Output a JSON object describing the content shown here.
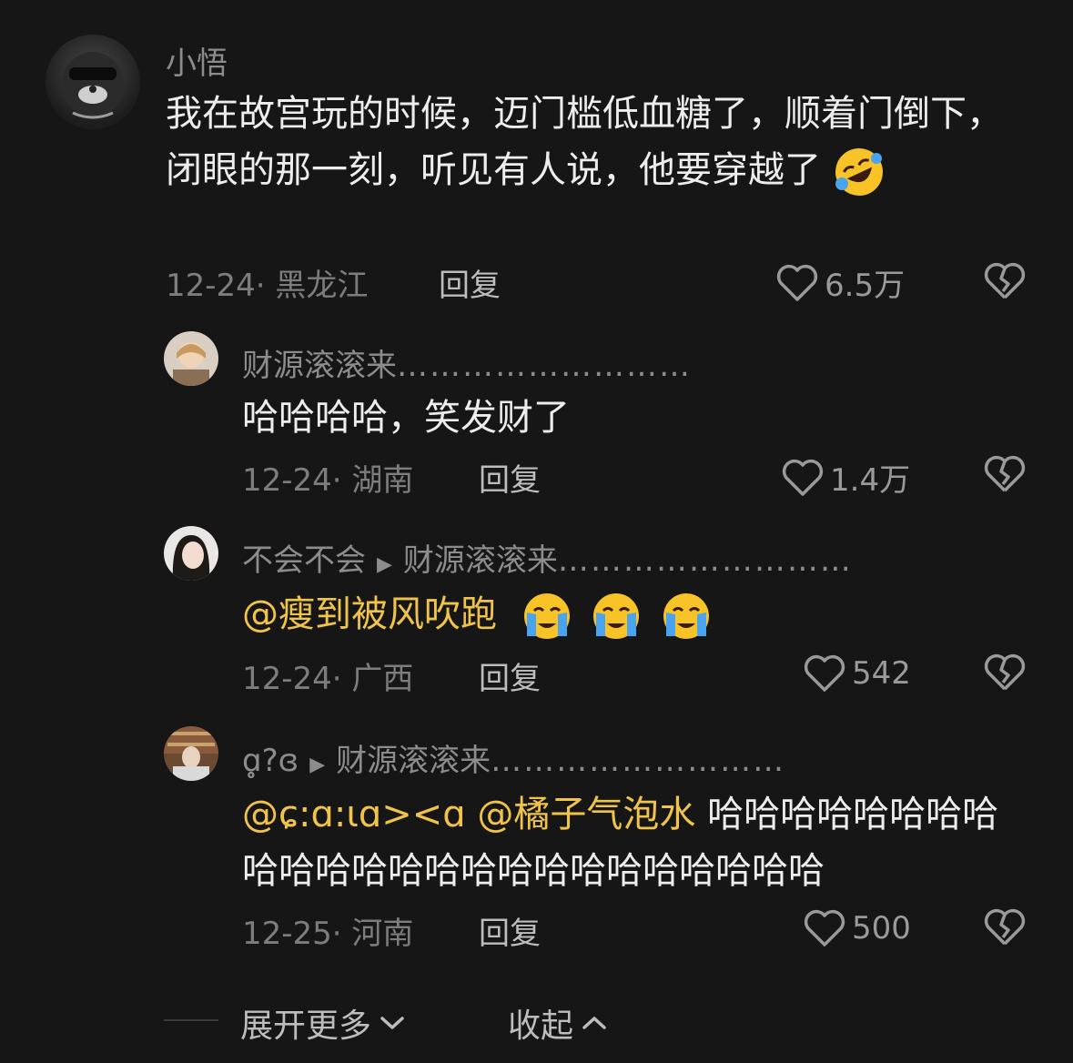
{
  "comments": [
    {
      "user": "小悟",
      "text": "我在故宫玩的时候，迈门槛低血糖了，顺着门倒下，闭眼的那一刻，听见有人说，他要穿越了",
      "emoji": "rofl-emoji",
      "date": "12-24",
      "location": "黑龙江",
      "reply_label": "回复",
      "likes": "6.5万"
    },
    {
      "user": "财源滚滚来",
      "user_dots": "………………………",
      "text": "哈哈哈哈，笑发财了",
      "date": "12-24",
      "location": "湖南",
      "reply_label": "回复",
      "likes": "1.4万"
    },
    {
      "user": "不会不会",
      "reply_to": "财源滚滚来",
      "reply_to_dots": "………………………",
      "mention": "@瘦到被风吹跑",
      "emojis": [
        "crying-face-emoji",
        "crying-face-emoji",
        "crying-face-emoji"
      ],
      "date": "12-24",
      "location": "广西",
      "reply_label": "回复",
      "likes": "542"
    },
    {
      "user": "ɑ̥̥̥̥̥̥?ɞ",
      "reply_to": "财源滚滚来",
      "reply_to_dots": "………………………",
      "mention1": "@ɕ:ɑ:ɩɑ><ɑ",
      "mention2": "@橘子气泡水",
      "text": "哈哈哈哈哈哈哈哈哈哈哈哈哈哈哈哈哈哈哈哈哈哈哈哈",
      "date": "12-25",
      "location": "河南",
      "reply_label": "回复",
      "likes": "500"
    }
  ],
  "footer": {
    "expand_label": "展开更多",
    "collapse_label": "收起"
  },
  "colors": {
    "background": "#161616",
    "mention": "#f0c34a",
    "muted": "#8c8c8c"
  }
}
